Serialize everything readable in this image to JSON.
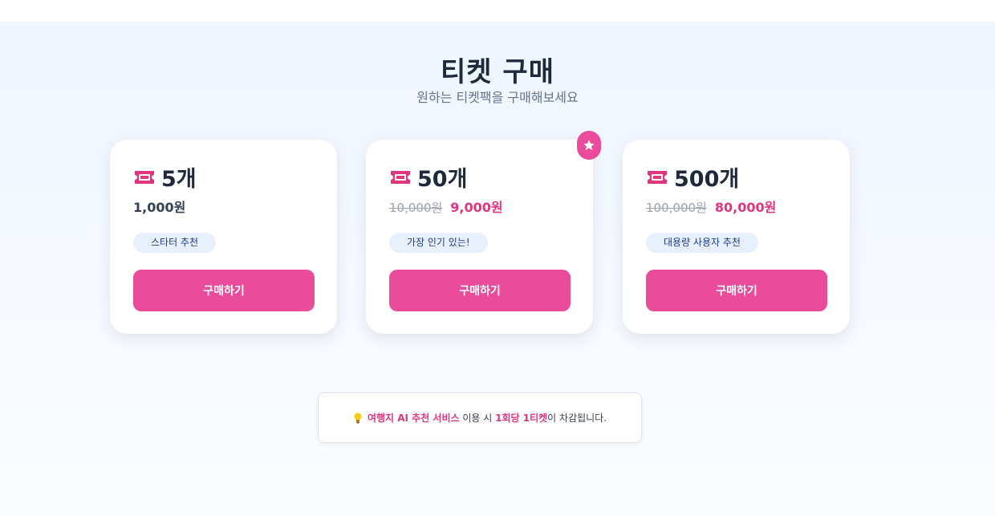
{
  "header": {
    "title": "티켓 구매",
    "subtitle": "원하는 티켓팩을 구매해보세요"
  },
  "cards": [
    {
      "count": "5개",
      "price": "1,000원",
      "tag": "스타터 추천",
      "button": "구매하기",
      "icon": "ticket-icon"
    },
    {
      "count": "50개",
      "old_price": "10,000원",
      "new_price": "9,000원",
      "tag": "가장 인기 있는!",
      "button": "구매하기",
      "icon": "ticket-icon",
      "badge_icon": "star-icon"
    },
    {
      "count": "500개",
      "old_price": "100,000원",
      "new_price": "80,000원",
      "tag": "대용량 사용자 추천",
      "button": "구매하기",
      "icon": "ticket-icon"
    }
  ],
  "notice": {
    "icon": "lightbulb-icon",
    "service": "여행지 AI 추천 서비스",
    "mid": " 이용 시 ",
    "cost": "1회당 1티켓",
    "end": "이 차감됩니다."
  },
  "colors": {
    "accent": "#ea4b9a",
    "accent_text": "#e0357f",
    "tag_bg": "#e8f0fe",
    "tag_text": "#1e3a8a",
    "title": "#1e293b"
  }
}
